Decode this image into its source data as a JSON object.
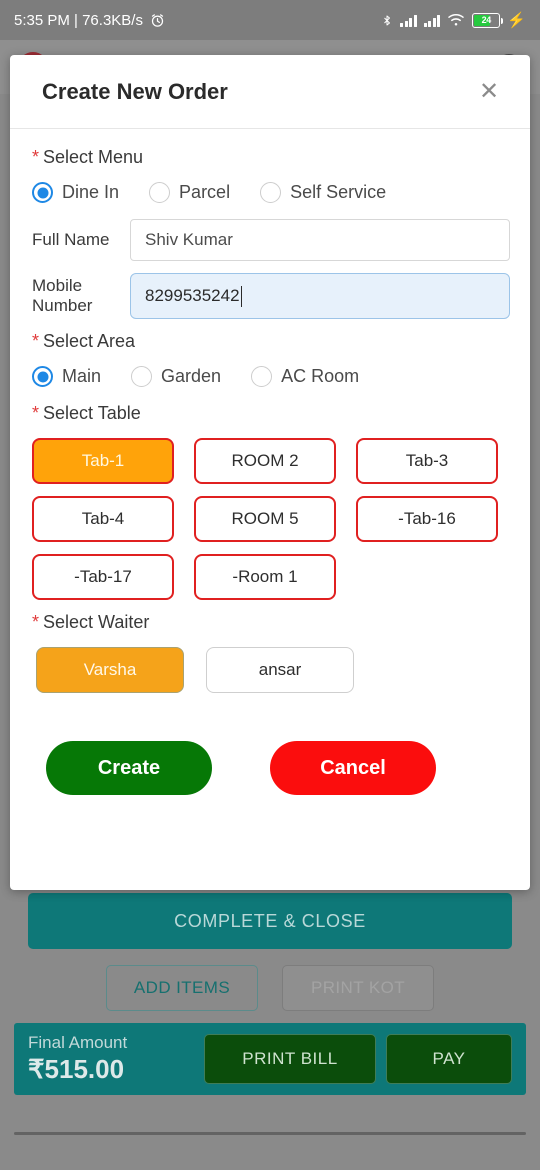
{
  "status_bar": {
    "time_and_speed": "5:35 PM | 76.3KB/s",
    "alarm_icon": "alarm-icon",
    "bluetooth_icon": "bluetooth-icon",
    "wifi_icon": "wifi-icon",
    "battery_percent": "24",
    "charging_icon": "charging-bolt-icon"
  },
  "modal": {
    "title": "Create New Order",
    "close_label": "✕",
    "menu_section": {
      "label": "Select Menu",
      "required_mark": "*",
      "options": [
        {
          "label": "Dine In",
          "selected": true
        },
        {
          "label": "Parcel",
          "selected": false
        },
        {
          "label": "Self Service",
          "selected": false
        }
      ]
    },
    "full_name": {
      "label": "Full Name",
      "value": "Shiv Kumar",
      "placeholder": "Full Name"
    },
    "mobile_number": {
      "label": "Mobile Number",
      "value": "8299535242",
      "placeholder": "Mobile Number",
      "focused": true
    },
    "area_section": {
      "label": "Select Area",
      "required_mark": "*",
      "options": [
        {
          "label": "Main",
          "selected": true
        },
        {
          "label": "Garden",
          "selected": false
        },
        {
          "label": "AC Room",
          "selected": false
        }
      ]
    },
    "table_section": {
      "label": "Select Table",
      "required_mark": "*",
      "tables": [
        {
          "label": "Tab-1",
          "selected": true
        },
        {
          "label": "ROOM 2",
          "selected": false
        },
        {
          "label": "Tab-3",
          "selected": false
        },
        {
          "label": "Tab-4",
          "selected": false
        },
        {
          "label": "ROOM 5",
          "selected": false
        },
        {
          "label": "-Tab-16",
          "selected": false
        },
        {
          "label": "-Tab-17",
          "selected": false
        },
        {
          "label": "-Room 1",
          "selected": false
        }
      ]
    },
    "waiter_section": {
      "label": "Select Waiter",
      "required_mark": "*",
      "waiters": [
        {
          "label": "Varsha",
          "selected": true
        },
        {
          "label": "ansar",
          "selected": false
        }
      ]
    },
    "actions": {
      "create_label": "Create",
      "cancel_label": "Cancel"
    }
  },
  "background_page": {
    "complete_close_label": "COMPLETE & CLOSE",
    "add_items_label": "ADD ITEMS",
    "print_kot_label": "PRINT KOT",
    "final_amount_label": "Final Amount",
    "final_amount_value": "₹515.00",
    "print_bill_label": "PRINT BILL",
    "pay_label": "PAY"
  },
  "colors": {
    "accent_orange": "#ffa30a",
    "chip_border_red": "#e02020",
    "radio_blue": "#1e88e5",
    "teal": "#0e7878",
    "create_green": "#067806",
    "cancel_red": "#fb0d0d",
    "required_star_red": "#e03b3b"
  }
}
